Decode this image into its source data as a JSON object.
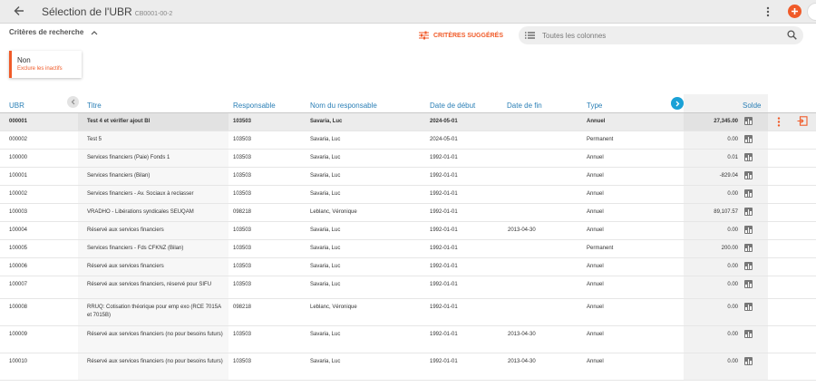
{
  "header": {
    "title": "Sélection de l'UBR",
    "code": "CB0001-00-2"
  },
  "criteria": {
    "toggle_label": "Critères de recherche",
    "suggested_label": "CRITÈRES SUGGÉRÉS",
    "search_placeholder": "Toutes les colonnes",
    "chip_value": "Non",
    "chip_subtitle": "Exclure les inactifs"
  },
  "colors": {
    "accent": "#f05a28",
    "header_text": "#2a7fb6",
    "nav_circle": "#1aa1d6"
  },
  "icons": {
    "back": "arrow-left-icon",
    "more": "kebab-icon",
    "add": "plus-circle-icon",
    "suggest": "tune-icon",
    "columns": "list-icon",
    "search": "search-icon",
    "collapse": "chevron-up-icon",
    "prev_cols": "chevron-left-icon",
    "next_cols": "chevron-right-icon",
    "solde": "bar-chart-icon",
    "goto": "goto-icon"
  },
  "table": {
    "columns": {
      "ubr": "UBR",
      "titre": "Titre",
      "responsable": "Responsable",
      "nom": "Nom du responsable",
      "debut": "Date de début",
      "fin": "Date de fin",
      "type": "Type",
      "solde": "Solde"
    },
    "rows": [
      {
        "ubr": "000001",
        "titre": "Test 4 et vérifier ajout BI",
        "responsable": "103503",
        "nom": "Savaria, Luc",
        "debut": "2024-05-01",
        "fin": "",
        "type": "Annuel",
        "solde": "27,345.00"
      },
      {
        "ubr": "000002",
        "titre": "Test 5",
        "responsable": "103503",
        "nom": "Savaria, Luc",
        "debut": "2024-05-01",
        "fin": "",
        "type": "Permanent",
        "solde": "0.00"
      },
      {
        "ubr": "100000",
        "titre": "Services financiers (Paie) Fonds 1",
        "responsable": "103503",
        "nom": "Savaria, Luc",
        "debut": "1992-01-01",
        "fin": "",
        "type": "Annuel",
        "solde": "0.01"
      },
      {
        "ubr": "100001",
        "titre": "Services financiers (Bilan)",
        "responsable": "103503",
        "nom": "Savaria, Luc",
        "debut": "1992-01-01",
        "fin": "",
        "type": "Annuel",
        "solde": "-829.04"
      },
      {
        "ubr": "100002",
        "titre": "Services financiers - Av. Sociaux à reclasser",
        "responsable": "103503",
        "nom": "Savaria, Luc",
        "debut": "1992-01-01",
        "fin": "",
        "type": "Annuel",
        "solde": "0.00"
      },
      {
        "ubr": "100003",
        "titre": "VRADHO - Libérations syndicales SEUQAM",
        "responsable": "098218",
        "nom": "Leblanc, Véronique",
        "debut": "1992-01-01",
        "fin": "",
        "type": "Annuel",
        "solde": "89,107.57"
      },
      {
        "ubr": "100004",
        "titre": "Réservé aux services financiers",
        "responsable": "103503",
        "nom": "Savaria, Luc",
        "debut": "1992-01-01",
        "fin": "2013-04-30",
        "type": "Annuel",
        "solde": "0.00"
      },
      {
        "ubr": "100005",
        "titre": "Services financiers - Fds CFKNZ (Bilan)",
        "responsable": "103503",
        "nom": "Savaria, Luc",
        "debut": "1992-01-01",
        "fin": "",
        "type": "Permanent",
        "solde": "200.00"
      },
      {
        "ubr": "100006",
        "titre": "Réservé aux services financiers",
        "responsable": "103503",
        "nom": "Savaria, Luc",
        "debut": "1992-01-01",
        "fin": "",
        "type": "Annuel",
        "solde": "0.00"
      },
      {
        "ubr": "100007",
        "titre": "Réservé aux services financiers, réservé pour SIFU",
        "responsable": "103503",
        "nom": "Savaria, Luc",
        "debut": "1992-01-01",
        "fin": "",
        "type": "Annuel",
        "solde": "0.00"
      },
      {
        "ubr": "100008",
        "titre": "RRUQ: Cotisation théorique pour emp exo (RCE 7015A et 7015B)",
        "responsable": "098218",
        "nom": "Leblanc, Véronique",
        "debut": "1992-01-01",
        "fin": "",
        "type": "Annuel",
        "solde": "0.00"
      },
      {
        "ubr": "100009",
        "titre": "Réservé aux services financiers (no pour besoins futurs)",
        "responsable": "103503",
        "nom": "Savaria, Luc",
        "debut": "1992-01-01",
        "fin": "2013-04-30",
        "type": "Annuel",
        "solde": "0.00"
      },
      {
        "ubr": "100010",
        "titre": "Réservé aux services financiers (no pour besoins futurs)",
        "responsable": "103503",
        "nom": "Savaria, Luc",
        "debut": "1992-01-01",
        "fin": "2013-04-30",
        "type": "Annuel",
        "solde": "0.00"
      }
    ]
  }
}
